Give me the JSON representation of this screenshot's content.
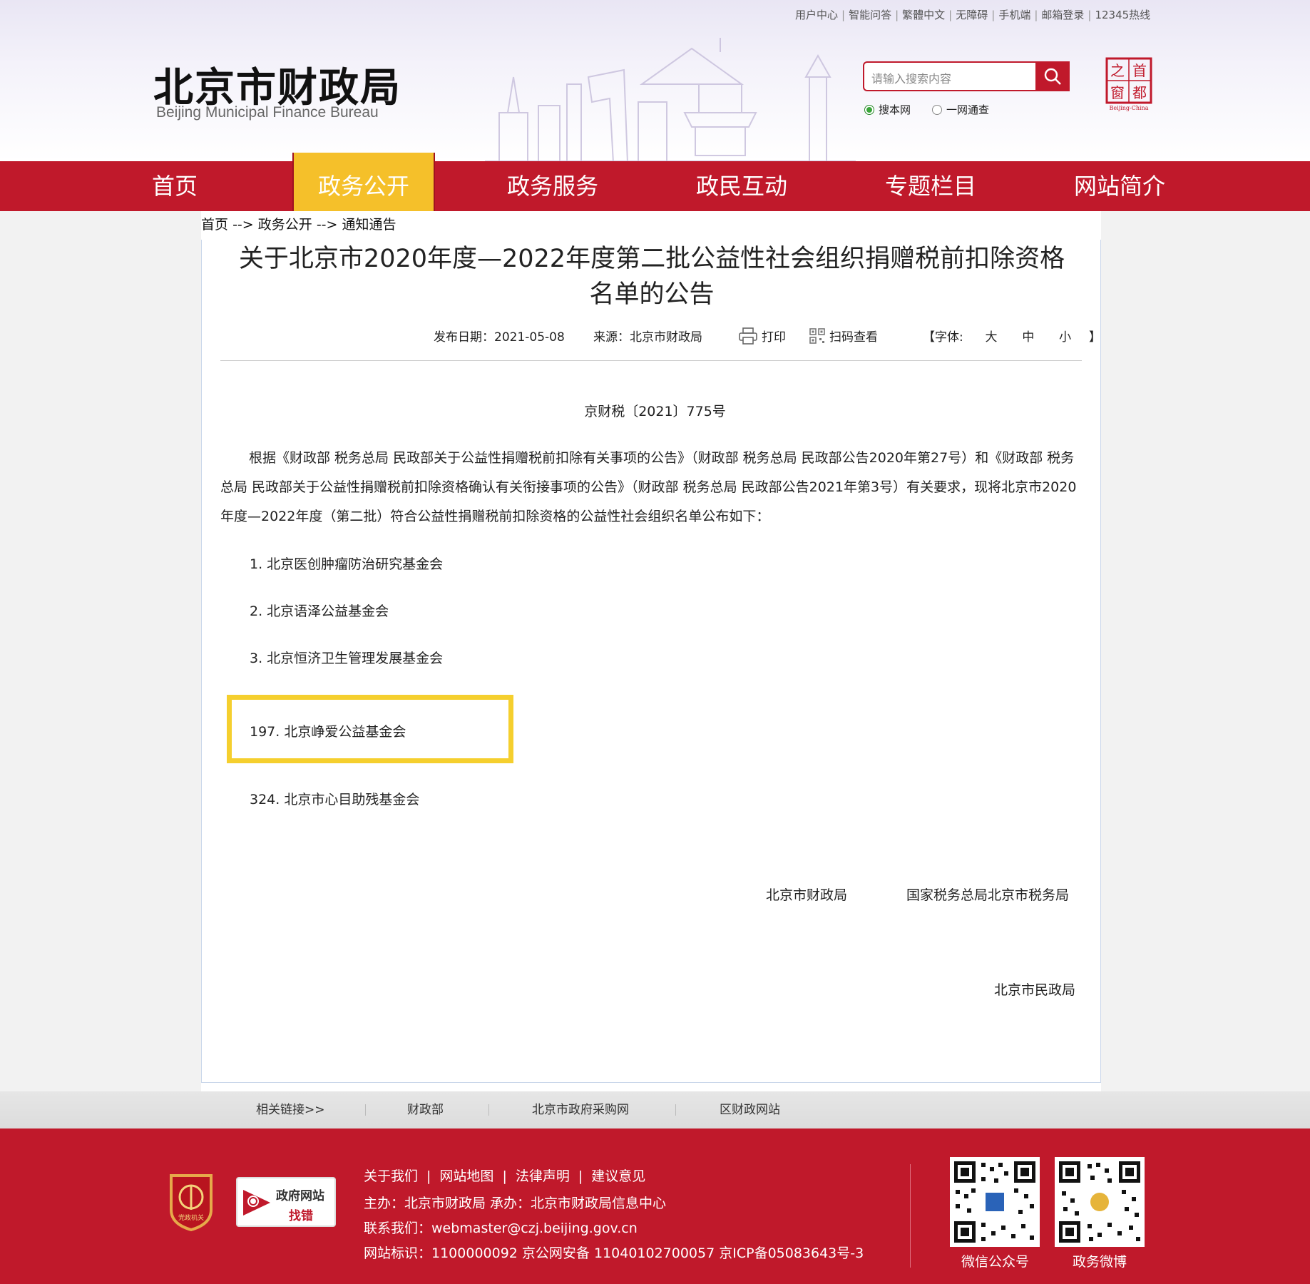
{
  "header": {
    "top_links": [
      "用户中心",
      "智能问答",
      "繁體中文",
      "无障碍",
      "手机端",
      "邮箱登录",
      "12345热线"
    ],
    "site_title_cn": "北京市财政局",
    "site_title_en": "Beijing Municipal Finance Bureau",
    "search_placeholder": "请输入搜索内容",
    "search_scope_options": [
      "搜本网",
      "一网通查"
    ],
    "search_scope_selected": "搜本网",
    "seal_text": [
      "首",
      "都",
      "之",
      "窗"
    ],
    "seal_caption": "Beijing-China"
  },
  "nav": {
    "items": [
      "首页",
      "政务公开",
      "政务服务",
      "政民互动",
      "专题栏目",
      "网站简介"
    ],
    "active": "政务公开"
  },
  "breadcrumb": {
    "items": [
      "首页",
      "政务公开",
      "通知通告"
    ],
    "separator": "-->"
  },
  "article": {
    "title_line1": "关于北京市2020年度—2022年度第二批公益性社会组织捐赠税前扣除资格",
    "title_line2": "名单的公告",
    "publish_date_label": "发布日期：",
    "publish_date": "2021-05-08",
    "source_label": "来源：",
    "source": "北京市财政局",
    "print_label": "打印",
    "qr_label": "扫码查看",
    "font_size_open": "【字体:",
    "font_sizes": [
      "大",
      "中",
      "小"
    ],
    "font_size_close": "】",
    "doc_number": "京财税〔2021〕775号",
    "body": "根据《财政部 税务总局 民政部关于公益性捐赠税前扣除有关事项的公告》（财政部 税务总局 民政部公告2020年第27号）和《财政部 税务总局 民政部关于公益性捐赠税前扣除资格确认有关衔接事项的公告》（财政部 税务总局 民政部公告2021年第3号）有关要求，现将北京市2020年度—2022年度（第二批）符合公益性捐赠税前扣除资格的公益性社会组织名单公布如下：",
    "list": [
      "1. 北京医创肿瘤防治研究基金会",
      "2. 北京语泽公益基金会",
      "3. 北京恒济卫生管理发展基金会",
      "197. 北京峥爱公益基金会",
      "324. 北京市心目助残基金会"
    ],
    "highlighted_item": "197. 北京峥爱公益基金会",
    "signatories": [
      "北京市财政局",
      "国家税务总局北京市税务局",
      "北京市民政局"
    ]
  },
  "related_links": [
    "相关链接>>",
    "财政部",
    "北京市政府采购网",
    "区财政网站"
  ],
  "footer": {
    "links": [
      "关于我们",
      "网站地图",
      "法律声明",
      "建议意见"
    ],
    "host_line": "主办：北京市财政局   承办：北京市财政局信息中心",
    "contact_line": "联系我们：webmaster@czj.beijing.gov.cn",
    "id_line": "网站标识：1100000092   京公网安备 11040102700057   京ICP备05083643号-3",
    "badge_text": "党政机关",
    "error_report_top": "政府网站",
    "error_report_bottom": "找错",
    "qr_labels": [
      "微信公众号",
      "政务微博"
    ]
  },
  "colors": {
    "brand_red": "#c0192b",
    "nav_active_yellow": "#f5c02a",
    "highlight_yellow": "#f5cf2e"
  }
}
